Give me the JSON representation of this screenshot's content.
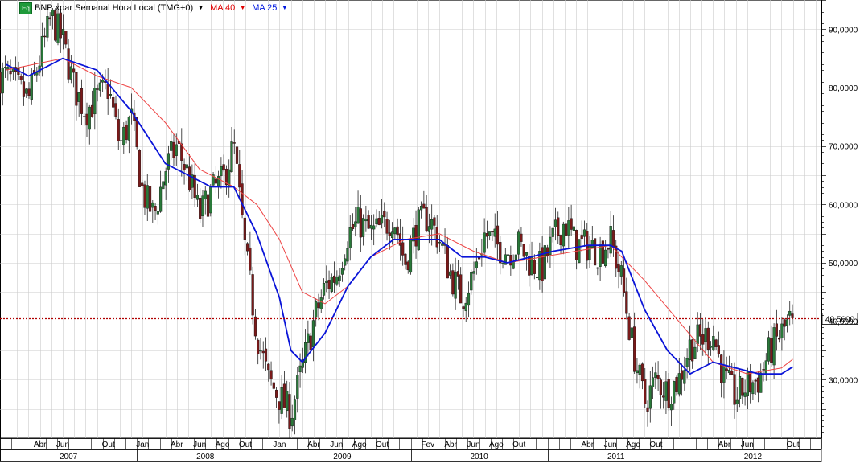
{
  "header": {
    "badge": "Eq",
    "instrument": "BNP:xpar Semanal Hora Local (TMG+0)",
    "ma40_label": "MA 40",
    "ma25_label": "MA 25"
  },
  "colors": {
    "up_candle": "#2a7a3a",
    "down_candle": "#7a1a1a",
    "ma40": "#ee4444",
    "ma25": "#0a14d8",
    "last_price_line": "#b00000",
    "grid": "#cccccc"
  },
  "chart_data": {
    "type": "candlestick",
    "title": "BNP:xpar Semanal Hora Local (TMG+0)",
    "frequency": "weekly",
    "x_range": [
      "2007-01",
      "2012-12"
    ],
    "ylim": [
      20,
      95
    ],
    "grid": true,
    "y_ticks": [
      {
        "value": 30,
        "label": "30,0000"
      },
      {
        "value": 40,
        "label": "40,0000"
      },
      {
        "value": 50,
        "label": "50,0000"
      },
      {
        "value": 60,
        "label": "60,0000"
      },
      {
        "value": 70,
        "label": "70,0000"
      },
      {
        "value": 80,
        "label": "80,0000"
      },
      {
        "value": 90,
        "label": "90,0000"
      }
    ],
    "last_price": {
      "value": 40.56,
      "label": "40,5600"
    },
    "month_ticks": [
      {
        "date": "2007-04",
        "label": "Abr"
      },
      {
        "date": "2007-06",
        "label": "Jun"
      },
      {
        "date": "2007-10",
        "label": "Out"
      },
      {
        "date": "2008-01",
        "label": "Jan"
      },
      {
        "date": "2008-04",
        "label": "Abr"
      },
      {
        "date": "2008-06",
        "label": "Jun"
      },
      {
        "date": "2008-08",
        "label": "Ago"
      },
      {
        "date": "2008-10",
        "label": "Out"
      },
      {
        "date": "2009-01",
        "label": "Jan"
      },
      {
        "date": "2009-04",
        "label": "Abr"
      },
      {
        "date": "2009-06",
        "label": "Jun"
      },
      {
        "date": "2009-08",
        "label": "Ago"
      },
      {
        "date": "2009-10",
        "label": "Out"
      },
      {
        "date": "2010-02",
        "label": "Fev"
      },
      {
        "date": "2010-04",
        "label": "Abr"
      },
      {
        "date": "2010-06",
        "label": "Jun"
      },
      {
        "date": "2010-08",
        "label": "Ago"
      },
      {
        "date": "2010-10",
        "label": "Out"
      },
      {
        "date": "2011-04",
        "label": "Abr"
      },
      {
        "date": "2011-06",
        "label": "Jun"
      },
      {
        "date": "2011-08",
        "label": "Ago"
      },
      {
        "date": "2011-10",
        "label": "Out"
      },
      {
        "date": "2012-04",
        "label": "Abr"
      },
      {
        "date": "2012-06",
        "label": "Jun"
      },
      {
        "date": "2012-10",
        "label": "Out"
      }
    ],
    "year_labels": [
      {
        "year": "2007",
        "label": "2007"
      },
      {
        "year": "2008",
        "label": "2008"
      },
      {
        "year": "2009",
        "label": "2009"
      },
      {
        "year": "2010",
        "label": "2010"
      },
      {
        "year": "2011",
        "label": "2011"
      },
      {
        "year": "2012",
        "label": "2012"
      }
    ],
    "price_path": [
      {
        "date": "2007-01",
        "close": 82
      },
      {
        "date": "2007-03",
        "close": 78
      },
      {
        "date": "2007-05",
        "close": 92
      },
      {
        "date": "2007-06",
        "close": 88
      },
      {
        "date": "2007-07",
        "close": 80
      },
      {
        "date": "2007-08",
        "close": 76
      },
      {
        "date": "2007-10",
        "close": 80
      },
      {
        "date": "2007-11",
        "close": 70
      },
      {
        "date": "2007-12",
        "close": 75
      },
      {
        "date": "2008-01",
        "close": 62
      },
      {
        "date": "2008-02",
        "close": 58
      },
      {
        "date": "2008-03",
        "close": 66
      },
      {
        "date": "2008-04",
        "close": 70
      },
      {
        "date": "2008-05",
        "close": 65
      },
      {
        "date": "2008-06",
        "close": 58
      },
      {
        "date": "2008-07",
        "close": 62
      },
      {
        "date": "2008-08",
        "close": 64
      },
      {
        "date": "2008-09",
        "close": 70
      },
      {
        "date": "2008-10",
        "close": 52
      },
      {
        "date": "2008-11",
        "close": 38
      },
      {
        "date": "2008-12",
        "close": 30
      },
      {
        "date": "2009-01",
        "close": 27
      },
      {
        "date": "2009-02",
        "close": 24
      },
      {
        "date": "2009-03",
        "close": 32
      },
      {
        "date": "2009-04",
        "close": 40
      },
      {
        "date": "2009-05",
        "close": 46
      },
      {
        "date": "2009-06",
        "close": 48
      },
      {
        "date": "2009-07",
        "close": 55
      },
      {
        "date": "2009-08",
        "close": 57
      },
      {
        "date": "2009-09",
        "close": 55
      },
      {
        "date": "2009-10",
        "close": 56
      },
      {
        "date": "2009-11",
        "close": 58
      },
      {
        "date": "2009-12",
        "close": 50
      },
      {
        "date": "2010-01",
        "close": 56
      },
      {
        "date": "2010-02",
        "close": 58
      },
      {
        "date": "2010-03",
        "close": 54
      },
      {
        "date": "2010-04",
        "close": 48
      },
      {
        "date": "2010-05",
        "close": 44
      },
      {
        "date": "2010-06",
        "close": 48
      },
      {
        "date": "2010-07",
        "close": 55
      },
      {
        "date": "2010-08",
        "close": 53
      },
      {
        "date": "2010-09",
        "close": 52
      },
      {
        "date": "2010-10",
        "close": 53
      },
      {
        "date": "2010-11",
        "close": 50
      },
      {
        "date": "2010-12",
        "close": 49
      },
      {
        "date": "2011-01",
        "close": 54
      },
      {
        "date": "2011-02",
        "close": 57
      },
      {
        "date": "2011-03",
        "close": 53
      },
      {
        "date": "2011-04",
        "close": 53
      },
      {
        "date": "2011-05",
        "close": 52
      },
      {
        "date": "2011-06",
        "close": 54
      },
      {
        "date": "2011-07",
        "close": 47
      },
      {
        "date": "2011-08",
        "close": 35
      },
      {
        "date": "2011-09",
        "close": 26
      },
      {
        "date": "2011-10",
        "close": 30
      },
      {
        "date": "2011-11",
        "close": 28
      },
      {
        "date": "2011-12",
        "close": 30
      },
      {
        "date": "2012-01",
        "close": 36
      },
      {
        "date": "2012-02",
        "close": 37
      },
      {
        "date": "2012-03",
        "close": 38
      },
      {
        "date": "2012-04",
        "close": 30
      },
      {
        "date": "2012-05",
        "close": 27
      },
      {
        "date": "2012-06",
        "close": 29
      },
      {
        "date": "2012-07",
        "close": 30
      },
      {
        "date": "2012-08",
        "close": 35
      },
      {
        "date": "2012-09",
        "close": 38
      },
      {
        "date": "2012-10",
        "close": 40.56
      }
    ],
    "series": [
      {
        "name": "MA 40",
        "points": [
          {
            "date": "2007-01",
            "value": 83
          },
          {
            "date": "2007-06",
            "value": 85
          },
          {
            "date": "2007-09",
            "value": 82
          },
          {
            "date": "2007-12",
            "value": 80
          },
          {
            "date": "2008-03",
            "value": 74
          },
          {
            "date": "2008-06",
            "value": 66
          },
          {
            "date": "2008-09",
            "value": 63
          },
          {
            "date": "2008-11",
            "value": 60
          },
          {
            "date": "2009-01",
            "value": 54
          },
          {
            "date": "2009-03",
            "value": 45
          },
          {
            "date": "2009-05",
            "value": 43
          },
          {
            "date": "2009-07",
            "value": 46
          },
          {
            "date": "2009-09",
            "value": 51
          },
          {
            "date": "2009-12",
            "value": 54
          },
          {
            "date": "2010-03",
            "value": 55
          },
          {
            "date": "2010-06",
            "value": 52
          },
          {
            "date": "2010-09",
            "value": 50
          },
          {
            "date": "2010-12",
            "value": 51
          },
          {
            "date": "2011-03",
            "value": 52
          },
          {
            "date": "2011-06",
            "value": 53
          },
          {
            "date": "2011-09",
            "value": 47
          },
          {
            "date": "2011-12",
            "value": 40
          },
          {
            "date": "2012-03",
            "value": 33
          },
          {
            "date": "2012-06",
            "value": 31
          },
          {
            "date": "2012-09",
            "value": 32
          },
          {
            "date": "2012-10",
            "value": 33.5
          }
        ]
      },
      {
        "name": "MA 25",
        "points": [
          {
            "date": "2007-01",
            "value": 84
          },
          {
            "date": "2007-03",
            "value": 82
          },
          {
            "date": "2007-06",
            "value": 85
          },
          {
            "date": "2007-09",
            "value": 83
          },
          {
            "date": "2007-12",
            "value": 76
          },
          {
            "date": "2008-03",
            "value": 67
          },
          {
            "date": "2008-05",
            "value": 65
          },
          {
            "date": "2008-07",
            "value": 63
          },
          {
            "date": "2008-09",
            "value": 63
          },
          {
            "date": "2008-11",
            "value": 55
          },
          {
            "date": "2009-01",
            "value": 44
          },
          {
            "date": "2009-02",
            "value": 35
          },
          {
            "date": "2009-03",
            "value": 33
          },
          {
            "date": "2009-05",
            "value": 38
          },
          {
            "date": "2009-07",
            "value": 46
          },
          {
            "date": "2009-09",
            "value": 51
          },
          {
            "date": "2009-11",
            "value": 54
          },
          {
            "date": "2010-01",
            "value": 54
          },
          {
            "date": "2010-03",
            "value": 54
          },
          {
            "date": "2010-05",
            "value": 51
          },
          {
            "date": "2010-07",
            "value": 51
          },
          {
            "date": "2010-09",
            "value": 50
          },
          {
            "date": "2010-11",
            "value": 51
          },
          {
            "date": "2011-01",
            "value": 52
          },
          {
            "date": "2011-04",
            "value": 53
          },
          {
            "date": "2011-06",
            "value": 53
          },
          {
            "date": "2011-07",
            "value": 52
          },
          {
            "date": "2011-09",
            "value": 42
          },
          {
            "date": "2011-11",
            "value": 35
          },
          {
            "date": "2012-01",
            "value": 31
          },
          {
            "date": "2012-03",
            "value": 33
          },
          {
            "date": "2012-05",
            "value": 32
          },
          {
            "date": "2012-07",
            "value": 31
          },
          {
            "date": "2012-09",
            "value": 31
          },
          {
            "date": "2012-10",
            "value": 32.2
          }
        ]
      }
    ]
  }
}
